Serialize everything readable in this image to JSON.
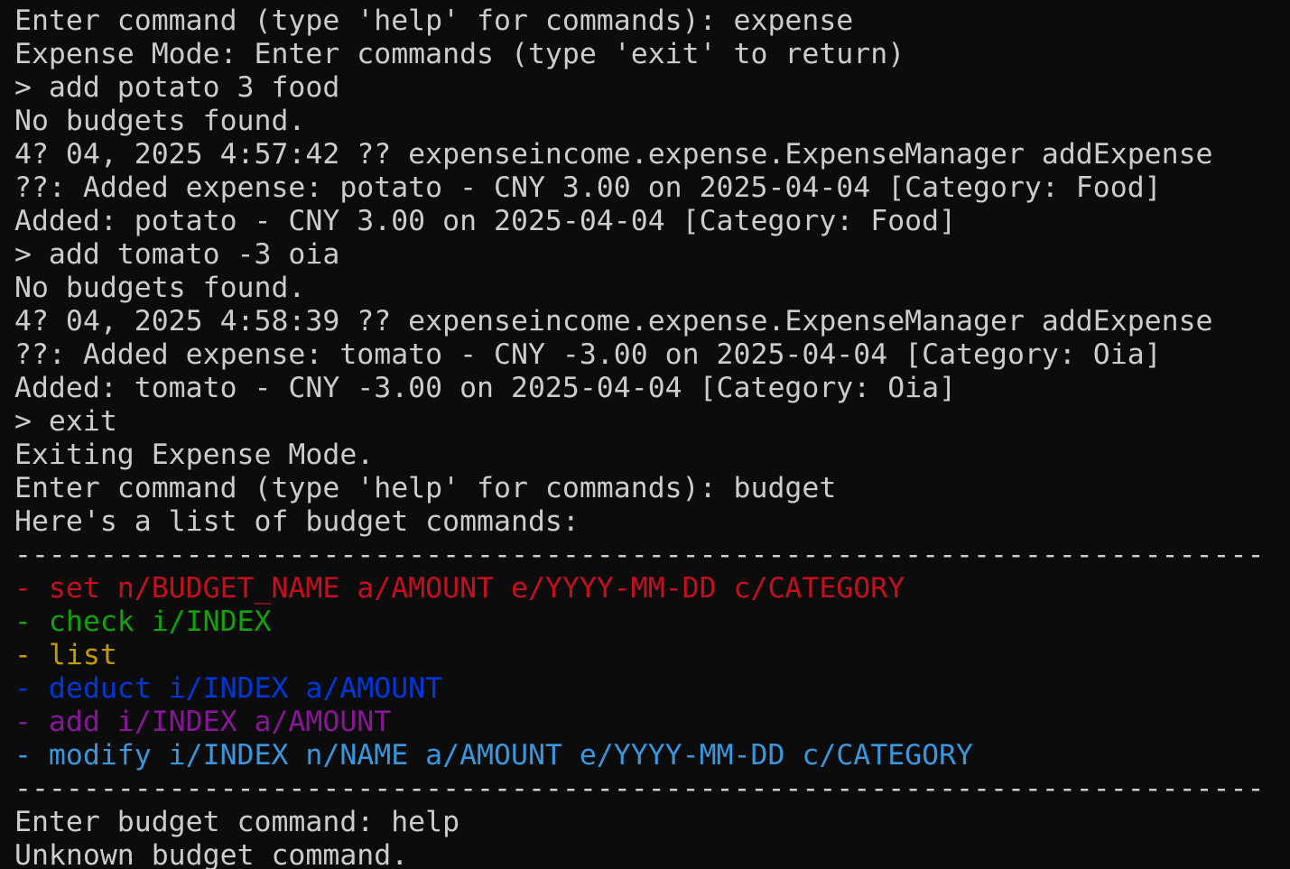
{
  "terminal": {
    "background": "#0c0c0c",
    "default_color": "#cccccc",
    "lines": [
      {
        "text": "Enter command (type 'help' for commands): expense",
        "color": "#cccccc"
      },
      {
        "text": "Expense Mode: Enter commands (type 'exit' to return)",
        "color": "#cccccc"
      },
      {
        "text": "> add potato 3 food",
        "color": "#cccccc"
      },
      {
        "text": "No budgets found.",
        "color": "#cccccc"
      },
      {
        "text": "4? 04, 2025 4:57:42 ?? expenseincome.expense.ExpenseManager addExpense",
        "color": "#cccccc"
      },
      {
        "text": "??: Added expense: potato - CNY 3.00 on 2025-04-04 [Category: Food]",
        "color": "#cccccc"
      },
      {
        "text": "Added: potato - CNY 3.00 on 2025-04-04 [Category: Food]",
        "color": "#cccccc"
      },
      {
        "text": "> add tomato -3 oia",
        "color": "#cccccc"
      },
      {
        "text": "No budgets found.",
        "color": "#cccccc"
      },
      {
        "text": "4? 04, 2025 4:58:39 ?? expenseincome.expense.ExpenseManager addExpense",
        "color": "#cccccc"
      },
      {
        "text": "??: Added expense: tomato - CNY -3.00 on 2025-04-04 [Category: Oia]",
        "color": "#cccccc"
      },
      {
        "text": "Added: tomato - CNY -3.00 on 2025-04-04 [Category: Oia]",
        "color": "#cccccc"
      },
      {
        "text": "> exit",
        "color": "#cccccc"
      },
      {
        "text": "Exiting Expense Mode.",
        "color": "#cccccc"
      },
      {
        "text": "Enter command (type 'help' for commands): budget",
        "color": "#cccccc"
      },
      {
        "text": "Here's a list of budget commands:",
        "color": "#cccccc"
      },
      {
        "text": "-------------------------------------------------------------------------",
        "color": "#cccccc"
      },
      {
        "text": "- set n/BUDGET_NAME a/AMOUNT e/YYYY-MM-DD c/CATEGORY",
        "color": "#c50f1f"
      },
      {
        "text": "- check i/INDEX",
        "color": "#13a10e"
      },
      {
        "text": "- list",
        "color": "#c19c00"
      },
      {
        "text": "- deduct i/INDEX a/AMOUNT",
        "color": "#0037da"
      },
      {
        "text": "- add i/INDEX a/AMOUNT",
        "color": "#881798"
      },
      {
        "text": "- modify i/INDEX n/NAME a/AMOUNT e/YYYY-MM-DD c/CATEGORY",
        "color": "#3a96dd"
      },
      {
        "text": "-------------------------------------------------------------------------",
        "color": "#cccccc"
      },
      {
        "text": "Enter budget command: help",
        "color": "#cccccc"
      },
      {
        "text": "Unknown budget command.",
        "color": "#cccccc"
      }
    ]
  }
}
